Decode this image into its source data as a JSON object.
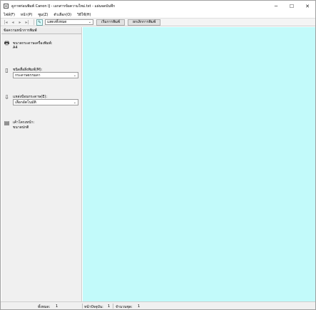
{
  "window": {
    "title": "ดูภาพก่อนพิมพ์ Canon IJ - เอกสารข้อความใหม่.txt - แผ่นจดบันทึก",
    "minimize_glyph": "─",
    "maximize_glyph": "☐",
    "close_glyph": "✕"
  },
  "menubar": {
    "items": [
      "ไฟล์(F)",
      "หน้า(P)",
      "ซูม(Z)",
      "ตัวเลือก(O)",
      "วิธีใช้(H)"
    ]
  },
  "toolbar": {
    "first_glyph": "|◂",
    "prev_glyph": "◂",
    "next_glyph": "▸",
    "last_glyph": "▸|",
    "zoom_select_value": "แสดงทั้งหมด",
    "start_print_label": "เริ่มการพิมพ์",
    "cancel_print_label": "ยกเลิกการพิมพ์"
  },
  "sidepanel": {
    "header": "ข้อความหน้าการพิมพ์",
    "paper_size_label": "ขนาดกระดาษเครื่องพิมพ์:",
    "paper_size_value": "A4",
    "media_type_label": "ชนิดสื่อสิ่งพิมพ์(M):",
    "media_type_value": "กระดาษธรรมดา",
    "paper_source_label": "แหล่งป้อนกระดาษ(E):",
    "paper_source_value": "เลือกอัตโนมัติ",
    "layout_label": "เค้าโครงหน้า:",
    "layout_value": "ขนาดปกติ"
  },
  "statusbar": {
    "pages_label": "ทั้งหมด:",
    "pages_value": "1",
    "current_label": "หน้าปัจจุบัน:",
    "current_value": "1",
    "copies_label": "จำนวนชุด:",
    "copies_value": "1"
  },
  "colors": {
    "preview_background": "#c2fafa",
    "panel_background": "#f0f0f0"
  }
}
